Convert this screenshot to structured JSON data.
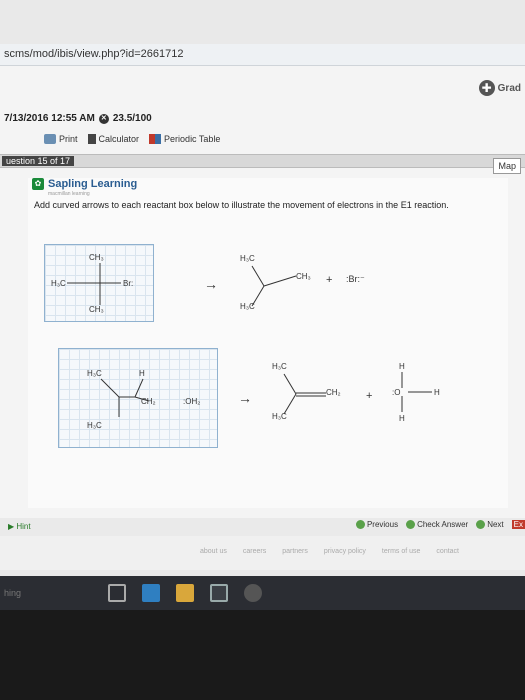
{
  "browser": {
    "url": "scms/mod/ibis/view.php?id=2661712"
  },
  "header": {
    "grade_label": "Grad"
  },
  "assignment": {
    "due": "7/13/2016 12:55 AM",
    "score": "23.5/100"
  },
  "tools": {
    "print": "Print",
    "calculator": "Calculator",
    "periodic_table": "Periodic Table"
  },
  "question": {
    "label": "uestion 15 of 17",
    "map_label": "Map"
  },
  "brand": {
    "name": "Sapling Learning",
    "tagline": "macmillan learning"
  },
  "instructions": "Add curved arrows to each reactant box below to illustrate the movement of electrons in the E1 reaction.",
  "reaction1": {
    "reactant": {
      "top": "CH₃",
      "left": "H₃C",
      "right": "Br:",
      "bottom": "CH₃"
    },
    "arrow": "→",
    "product": {
      "top": "H₃C",
      "right": "CH₃",
      "bottom": "H₃C"
    },
    "plus": "+",
    "byproduct": ":Br:⁻"
  },
  "reaction2": {
    "reactant": {
      "tl": "H₃C",
      "tr": "H",
      "right": "CH₂",
      "bottom": "H₃C",
      "water": ":OH₂"
    },
    "arrow": "→",
    "product": {
      "top": "H₃C",
      "right": "CH₂",
      "bottom": "H₃C"
    },
    "plus": "+",
    "byproduct": {
      "top": "H",
      "o": ":O",
      "right": "H",
      "bottom": "H"
    }
  },
  "footer": {
    "hint": "Hint",
    "previous": "Previous",
    "check": "Check Answer",
    "next": "Next",
    "exit": "Ex"
  },
  "links": [
    "about us",
    "careers",
    "partners",
    "privacy policy",
    "terms of use",
    "contact"
  ],
  "taskbar": {
    "start_text": "hing"
  }
}
